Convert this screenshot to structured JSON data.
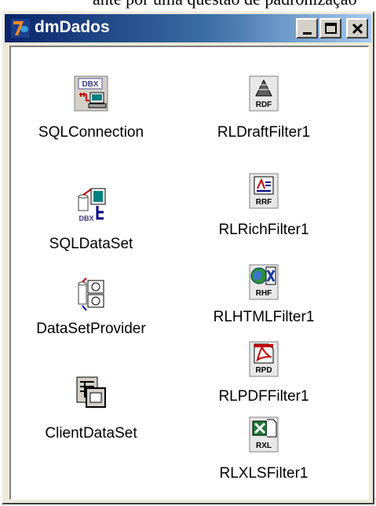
{
  "background_text": "ante por uma questão de padronização",
  "window": {
    "title": "dmDados",
    "buttons": {
      "minimize": "minimize",
      "maximize": "maximize",
      "close": "close"
    }
  },
  "components": [
    {
      "label": "SQLConnection",
      "icon": "dbx-sqlconnection-icon"
    },
    {
      "label": "SQLDataSet",
      "icon": "dbx-sqldataset-icon"
    },
    {
      "label": "DataSetProvider",
      "icon": "datasetprovider-icon"
    },
    {
      "label": "ClientDataSet",
      "icon": "clientdataset-icon"
    },
    {
      "label": "RLDraftFilter1",
      "icon": "rdf-filter-icon",
      "badge": "RDF"
    },
    {
      "label": "RLRichFilter1",
      "icon": "rrf-filter-icon",
      "badge": "RRF"
    },
    {
      "label": "RLHTMLFilter1",
      "icon": "rhf-filter-icon",
      "badge": "RHF"
    },
    {
      "label": "RLPDFFilter1",
      "icon": "rpd-filter-icon",
      "badge": "RPD"
    },
    {
      "label": "RLXLSFilter1",
      "icon": "rxl-filter-icon",
      "badge": "RXL"
    }
  ],
  "icon_texts": {
    "dbx": "DBX"
  }
}
